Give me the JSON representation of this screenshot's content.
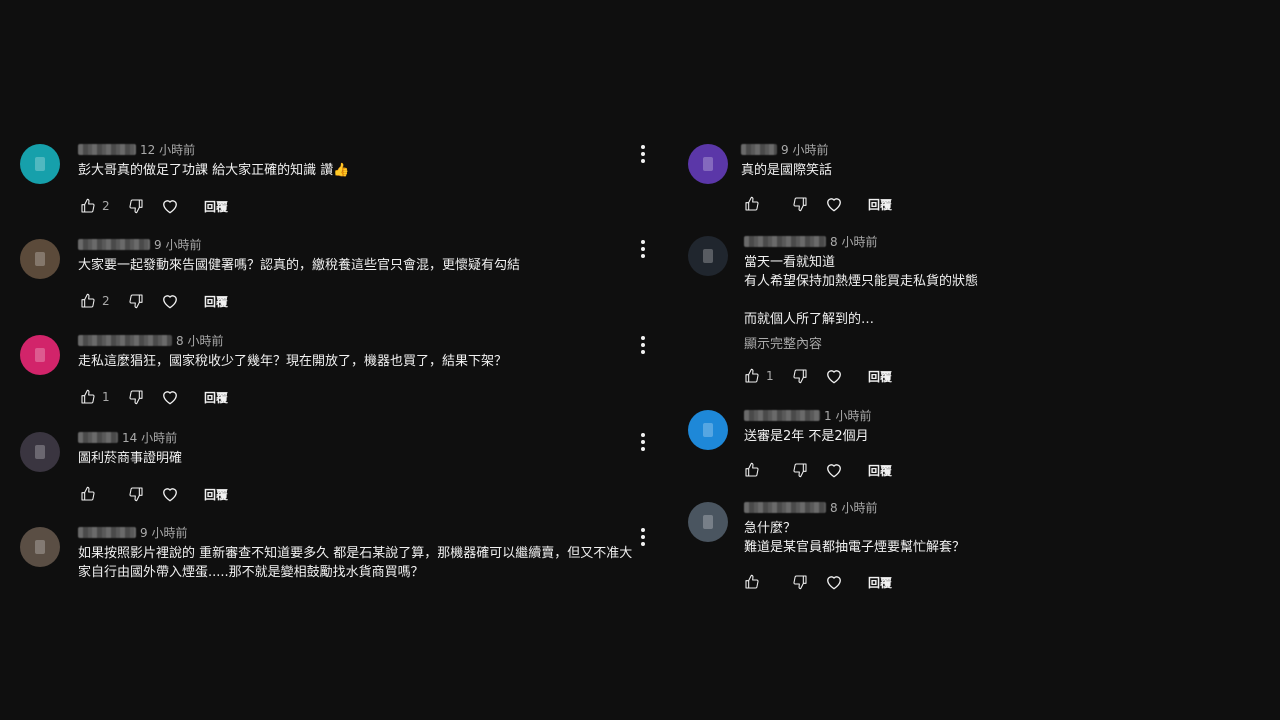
{
  "reply_label": "回覆",
  "show_more_label": "顯示完整內容",
  "left_comments": [
    {
      "time": "12 小時前",
      "text": "彭大哥真的做足了功課 給大家正確的知識 讚👍",
      "likes": "2",
      "avatar_color": "#16a0ab"
    },
    {
      "time": "9 小時前",
      "text": "大家要一起發動來告國健署嗎？認真的，繳稅養這些官只會混，更懷疑有勾結",
      "likes": "2",
      "avatar_color": "#5b4a3a"
    },
    {
      "time": "8 小時前",
      "text": "走私這麼猖狂，國家稅收少了幾年？現在開放了，機器也買了，結果下架？",
      "likes": "1",
      "avatar_color": "#d2246a"
    },
    {
      "time": "14 小時前",
      "text": "圖利菸商事證明確",
      "likes": "",
      "avatar_color": "#3a3540"
    },
    {
      "time": "9 小時前",
      "text": "如果按照影片裡說的 重新審查不知道要多久 都是石某說了算，那機器確可以繼續賣，但又不准大\n家自行由國外帶入煙蛋.....那不就是變相鼓勵找水貨商買嗎？",
      "likes": "",
      "avatar_color": "#5a4e44"
    }
  ],
  "right_comments": [
    {
      "time": "9 小時前",
      "text": "真的是國際笑話",
      "likes": "",
      "avatar_color": "#5b37a8"
    },
    {
      "time": "8 小時前",
      "text": "當天一看就知道\n有人希望保持加熱煙只能買走私貨的狀態\n\n而就個人所了解到的…",
      "likes": "1",
      "avatar_color": "#20262e"
    },
    {
      "time": "1 小時前",
      "text": "送審是2年  不是2個月",
      "likes": "",
      "avatar_color": "#1e88d8"
    },
    {
      "time": "8 小時前",
      "text": "急什麼？\n難道是某官員都抽電子煙要幫忙解套？",
      "likes": "",
      "avatar_color": "#4a5560"
    }
  ]
}
